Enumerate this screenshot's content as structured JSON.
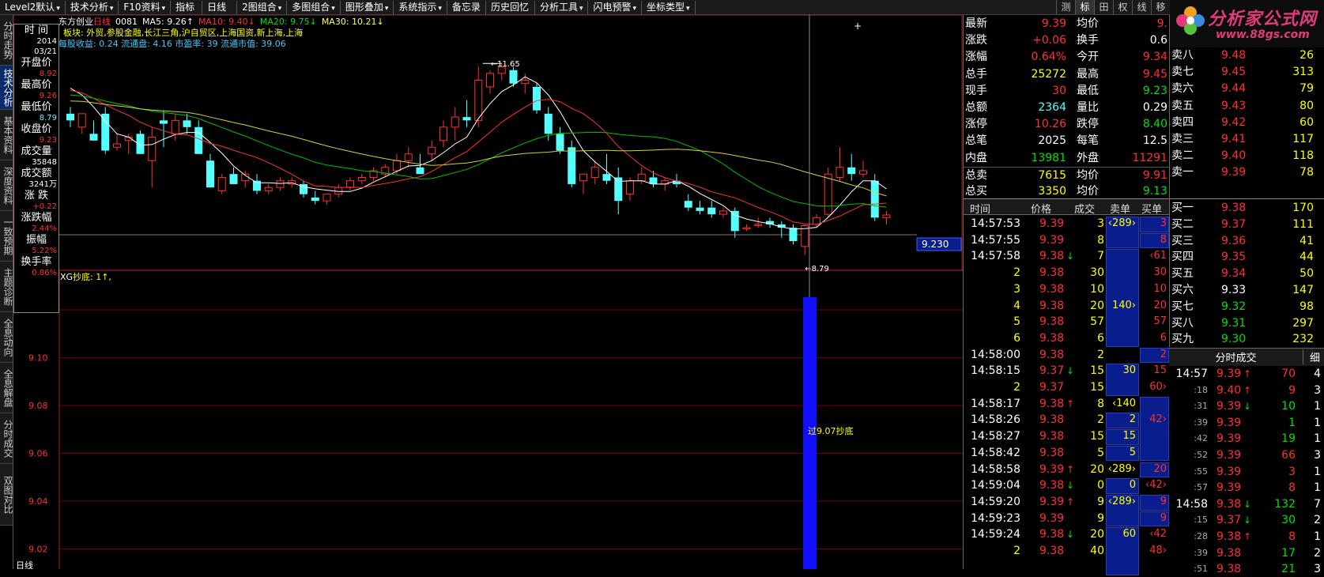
{
  "toolbar": {
    "items": [
      "Level2默认",
      "技术分析",
      "F10资料",
      "指标",
      "日线",
      "2图组合",
      "多图组合",
      "图形叠加",
      "系统指示",
      "备忘录",
      "历史回忆",
      "分析工具",
      "闪电预警",
      "坐标类型"
    ],
    "right_items": [
      "测",
      "标",
      "田",
      "权",
      "线",
      "移"
    ]
  },
  "logo": {
    "title": "分析家公式网",
    "url": "www.88gs.com"
  },
  "left_tabs": [
    "分时走势",
    "技术分析",
    "基本资料",
    "深度资料",
    "一致预期",
    "主题诊断",
    "全息动向",
    "全息解盘",
    "分时成交",
    "双图对比"
  ],
  "chart": {
    "header": "东方创业",
    "period": "日线",
    "code": "0081",
    "ma_line": [
      {
        "label": "MA5: 9.26↑",
        "color": "#ffffff"
      },
      {
        "label": "MA10: 9.40↓",
        "color": "#ff3030"
      },
      {
        "label": "MA20: 9.75↓",
        "color": "#00e000"
      },
      {
        "label": "MA30: 10.21↓",
        "color": "#ffff60"
      }
    ],
    "sector_line": "板块: 外贸,参股金融,长江三角,沪自贸区,上海国资,新上海,上海",
    "finance_line": "每股收益: 0.24  流通盘: 4.16  市盈率: 39  流通市值: 39.06",
    "high_label": "11.65",
    "low_label": "8.79",
    "cursor_price": "9.230",
    "indicator_header": "XG 抄底: 1↑,",
    "annotation": "过9.07抄底",
    "y_ticks": [
      "9.12",
      "9.10",
      "9.08",
      "9.06",
      "9.04",
      "9.02",
      "9.00"
    ],
    "bottom_label": "日线"
  },
  "info_box": [
    {
      "label": "时 间",
      "value": "2014"
    },
    {
      "label": "",
      "value": "03/21"
    },
    {
      "label": "开盘价",
      "value": "8.92"
    },
    {
      "label": "最高价",
      "value": "9.26"
    },
    {
      "label": "最低价",
      "value": "8.79"
    },
    {
      "label": "收盘价",
      "value": "9.23"
    },
    {
      "label": "成交量",
      "value": "35848"
    },
    {
      "label": "成交额",
      "value": "3241万"
    },
    {
      "label": "涨 跌",
      "value": "+0.22"
    },
    {
      "label": "涨跌幅",
      "value": "2.44%"
    },
    {
      "label": "振幅",
      "value": "5.22%"
    },
    {
      "label": "换手率",
      "value": "0.86%"
    }
  ],
  "quote": [
    {
      "l1": "最新",
      "v1": "9.39",
      "c1": "red",
      "l2": "均价",
      "v2": "9.",
      "c2": "red"
    },
    {
      "l1": "涨跌",
      "v1": "+0.06",
      "c1": "red",
      "l2": "换手",
      "v2": "0.6",
      "c2": "wht"
    },
    {
      "l1": "涨幅",
      "v1": "0.64%",
      "c1": "red",
      "l2": "今开",
      "v2": "9.34",
      "c2": "red"
    },
    {
      "l1": "总手",
      "v1": "25272",
      "c1": "yel",
      "l2": "最高",
      "v2": "9.45",
      "c2": "red"
    },
    {
      "l1": "现手",
      "v1": "30",
      "c1": "red",
      "l2": "最低",
      "v2": "9.23",
      "c2": "grn"
    },
    {
      "l1": "总额",
      "v1": "2364",
      "c1": "cyan",
      "l2": "量比",
      "v2": "0.29",
      "c2": "wht"
    },
    {
      "l1": "涨停",
      "v1": "10.26",
      "c1": "red",
      "l2": "跌停",
      "v2": "8.40",
      "c2": "grn"
    },
    {
      "l1": "总笔",
      "v1": "2025",
      "c1": "wht",
      "l2": "每笔",
      "v2": "12.5",
      "c2": "wht"
    },
    {
      "l1": "内盘",
      "v1": "13981",
      "c1": "grn",
      "l2": "外盘",
      "v2": "11291",
      "c2": "red"
    },
    {
      "l1": "总卖",
      "v1": "7615",
      "c1": "yel",
      "l2": "均价",
      "v2": "9.91",
      "c2": "red"
    },
    {
      "l1": "总买",
      "v1": "3350",
      "c1": "yel",
      "l2": "均价",
      "v2": "9.13",
      "c2": "grn"
    }
  ],
  "sell_book": [
    {
      "label": "卖十",
      "price": "",
      "vol": ""
    },
    {
      "label": "卖九",
      "price": "",
      "vol": ""
    },
    {
      "label": "卖八",
      "price": "9.48",
      "vol": "26"
    },
    {
      "label": "卖七",
      "price": "9.45",
      "vol": "313"
    },
    {
      "label": "卖六",
      "price": "9.44",
      "vol": "79"
    },
    {
      "label": "卖五",
      "price": "9.43",
      "vol": "80"
    },
    {
      "label": "卖四",
      "price": "9.42",
      "vol": "60"
    },
    {
      "label": "卖三",
      "price": "9.41",
      "vol": "117"
    },
    {
      "label": "卖二",
      "price": "9.40",
      "vol": "118"
    },
    {
      "label": "卖一",
      "price": "9.39",
      "vol": "78"
    }
  ],
  "buy_book": [
    {
      "label": "买一",
      "price": "9.38",
      "vol": "170",
      "pc": "red"
    },
    {
      "label": "买二",
      "price": "9.37",
      "vol": "111",
      "pc": "red"
    },
    {
      "label": "买三",
      "price": "9.36",
      "vol": "41",
      "pc": "red"
    },
    {
      "label": "买四",
      "price": "9.35",
      "vol": "44",
      "pc": "red"
    },
    {
      "label": "买五",
      "price": "9.34",
      "vol": "50",
      "pc": "red"
    },
    {
      "label": "买六",
      "price": "9.33",
      "vol": "147",
      "pc": "wht"
    },
    {
      "label": "买七",
      "price": "9.32",
      "vol": "98",
      "pc": "grn"
    },
    {
      "label": "买八",
      "price": "9.31",
      "vol": "297",
      "pc": "grn"
    },
    {
      "label": "买九",
      "price": "9.30",
      "vol": "232",
      "pc": "grn"
    },
    {
      "label": "买十",
      "price": "9.29",
      "vol": "4",
      "pc": "grn"
    }
  ],
  "tick_headers": [
    "时间",
    "价格",
    "成交",
    "卖单",
    "买单"
  ],
  "ticks": [
    {
      "t": "14:57:53",
      "p": "9.39",
      "pc": "red",
      "a": "",
      "v": "3",
      "s": "‹289›",
      "b": "3"
    },
    {
      "t": "14:57:55",
      "p": "9.39",
      "pc": "red",
      "a": "",
      "v": "8",
      "s": "",
      "b": "8"
    },
    {
      "t": "14:57:58",
      "p": "9.38",
      "pc": "red",
      "a": "↓",
      "v": "7",
      "s": "",
      "b": "‹61"
    },
    {
      "t": "2",
      "p": "9.38",
      "pc": "red",
      "a": "",
      "v": "30",
      "s": "",
      "b": "30"
    },
    {
      "t": "3",
      "p": "9.38",
      "pc": "red",
      "a": "",
      "v": "10",
      "s": "",
      "b": "10"
    },
    {
      "t": "4",
      "p": "9.38",
      "pc": "red",
      "a": "",
      "v": "20",
      "s": "140›",
      "b": "20"
    },
    {
      "t": "5",
      "p": "9.38",
      "pc": "red",
      "a": "",
      "v": "57",
      "s": "",
      "b": "57"
    },
    {
      "t": "6",
      "p": "9.38",
      "pc": "red",
      "a": "",
      "v": "6",
      "s": "",
      "b": "6"
    },
    {
      "t": "14:58:00",
      "p": "9.38",
      "pc": "red",
      "a": "",
      "v": "2",
      "s": "",
      "b": "2"
    },
    {
      "t": "14:58:15",
      "p": "9.37",
      "pc": "red",
      "a": "↓",
      "v": "15",
      "s": "30",
      "b": "15"
    },
    {
      "t": "2",
      "p": "9.37",
      "pc": "red",
      "a": "",
      "v": "15",
      "s": "",
      "b": "60›"
    },
    {
      "t": "14:58:17",
      "p": "9.38",
      "pc": "red",
      "a": "↑",
      "v": "8",
      "s": "‹140",
      "b": ""
    },
    {
      "t": "14:58:26",
      "p": "9.38",
      "pc": "red",
      "a": "",
      "v": "2",
      "s": "2",
      "b": "42›"
    },
    {
      "t": "14:58:27",
      "p": "9.38",
      "pc": "red",
      "a": "",
      "v": "15",
      "s": "15",
      "b": ""
    },
    {
      "t": "14:58:42",
      "p": "9.38",
      "pc": "red",
      "a": "",
      "v": "5",
      "s": "5",
      "b": ""
    },
    {
      "t": "14:58:58",
      "p": "9.39",
      "pc": "red",
      "a": "↑",
      "v": "20",
      "s": "‹289›",
      "b": "20"
    },
    {
      "t": "14:59:04",
      "p": "9.38",
      "pc": "red",
      "a": "↓",
      "v": "0",
      "s": "0",
      "b": "‹42›"
    },
    {
      "t": "14:59:20",
      "p": "9.39",
      "pc": "red",
      "a": "↑",
      "v": "9",
      "s": "‹289›",
      "b": "9"
    },
    {
      "t": "14:59:23",
      "p": "9.39",
      "pc": "red",
      "a": "",
      "v": "9",
      "s": "",
      "b": "9"
    },
    {
      "t": "14:59:24",
      "p": "9.38",
      "pc": "red",
      "a": "↓",
      "v": "20",
      "s": "60",
      "b": "‹42"
    },
    {
      "t": "2",
      "p": "9.38",
      "pc": "red",
      "a": "",
      "v": "40",
      "s": "",
      "b": "48›"
    },
    {
      "t": "",
      "p": "",
      "pc": "red",
      "a": "",
      "v": "",
      "s": "",
      "b": ""
    }
  ],
  "fenshi": {
    "title": "分时成交",
    "detail": "细",
    "rows": [
      {
        "t": "14:57",
        "p": "9.39",
        "a": "↑",
        "pc": "red",
        "v": "70",
        "vc": "red",
        "n": "4"
      },
      {
        "t": ":18",
        "p": "9.40",
        "a": "↑",
        "pc": "red",
        "v": "9",
        "vc": "red",
        "n": "3"
      },
      {
        "t": ":31",
        "p": "9.39",
        "a": "↓",
        "pc": "red",
        "v": "10",
        "vc": "grn",
        "n": "1"
      },
      {
        "t": ":39",
        "p": "9.39",
        "a": "",
        "pc": "red",
        "v": "1",
        "vc": "grn",
        "n": "1"
      },
      {
        "t": ":42",
        "p": "9.39",
        "a": "",
        "pc": "red",
        "v": "19",
        "vc": "grn",
        "n": "1"
      },
      {
        "t": ":52",
        "p": "9.39",
        "a": "",
        "pc": "red",
        "v": "66",
        "vc": "red",
        "n": "3"
      },
      {
        "t": ":55",
        "p": "9.39",
        "a": "",
        "pc": "red",
        "v": "3",
        "vc": "red",
        "n": "1"
      },
      {
        "t": ":57",
        "p": "9.39",
        "a": "",
        "pc": "red",
        "v": "8",
        "vc": "red",
        "n": "1"
      },
      {
        "t": "14:58",
        "p": "9.38",
        "a": "↓",
        "pc": "red",
        "v": "132",
        "vc": "grn",
        "n": "7"
      },
      {
        "t": ":15",
        "p": "9.37",
        "a": "↓",
        "pc": "red",
        "v": "30",
        "vc": "grn",
        "n": "2"
      },
      {
        "t": ":28",
        "p": "9.38",
        "a": "↑",
        "pc": "red",
        "v": "8",
        "vc": "red",
        "n": "1"
      },
      {
        "t": ":39",
        "p": "9.38",
        "a": "",
        "pc": "red",
        "v": "17",
        "vc": "grn",
        "n": "2"
      },
      {
        "t": ":51",
        "p": "9.38",
        "a": "",
        "pc": "red",
        "v": "21",
        "vc": "grn",
        "n": "3"
      }
    ]
  },
  "colors": {
    "up": "#ff3030",
    "down": "#54ffff",
    "ma5": "#ffffff",
    "ma10": "#ff3030",
    "ma20": "#00c000",
    "ma30": "#d0d040",
    "bar": "#1010ff"
  }
}
